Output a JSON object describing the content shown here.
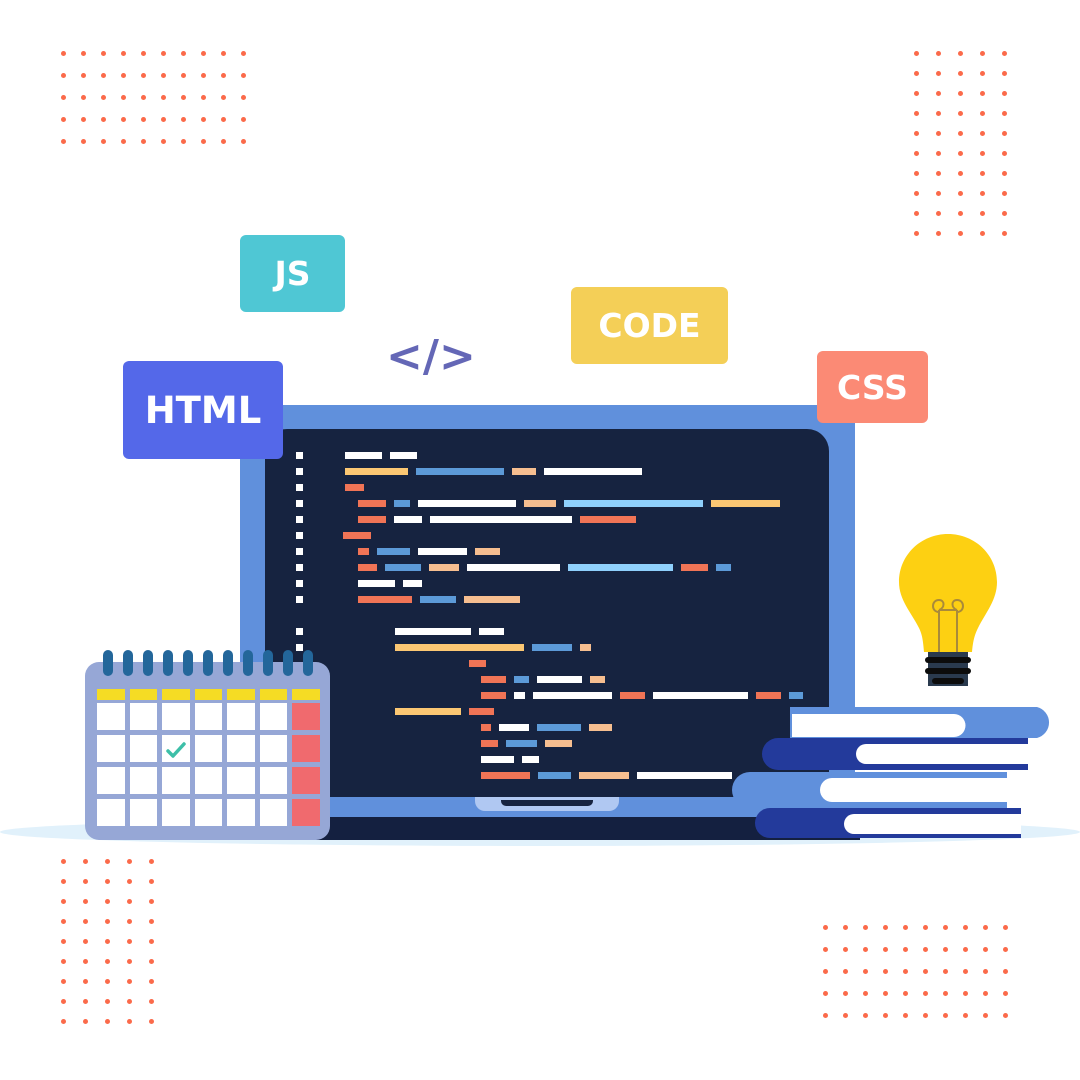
{
  "illustration": {
    "title": "Web development coding illustration",
    "tags": [
      {
        "id": "js",
        "label": "JS",
        "color": "#4fc7d4"
      },
      {
        "id": "html",
        "label": "HTML",
        "color": "#5468e9"
      },
      {
        "id": "code",
        "label": "CODE",
        "color": "#f4cf57"
      },
      {
        "id": "css",
        "label": "CSS",
        "color": "#fb8a75"
      }
    ],
    "code_symbol": "</>",
    "code_symbol_color": "#6467b6",
    "dot_color": "#fb6a4a"
  },
  "palette": {
    "w": "#ffffff",
    "o": "#fbc773",
    "b": "#5c9ad8",
    "p": "#f6be90",
    "r": "#f07456",
    "l": "#8fd0fc"
  },
  "code_lines": [
    {
      "gutter": true,
      "indent": 0,
      "segs": [
        [
          "w",
          37
        ],
        [
          "w",
          27
        ]
      ]
    },
    {
      "gutter": true,
      "indent": 0,
      "segs": [
        [
          "o",
          63
        ],
        [
          "b",
          88
        ],
        [
          "p",
          24
        ],
        [
          "w",
          98
        ]
      ]
    },
    {
      "gutter": true,
      "indent": 0,
      "segs": [
        [
          "r",
          19
        ]
      ]
    },
    {
      "gutter": true,
      "indent": 13,
      "segs": [
        [
          "r",
          28
        ],
        [
          "b",
          16
        ],
        [
          "w",
          98
        ],
        [
          "p",
          32
        ],
        [
          "l",
          139
        ],
        [
          "o",
          69
        ]
      ]
    },
    {
      "gutter": true,
      "indent": 13,
      "segs": [
        [
          "r",
          28
        ],
        [
          "w",
          28
        ],
        [
          "w",
          142
        ],
        [
          "r",
          56
        ]
      ]
    },
    {
      "gutter": true,
      "indent": -2,
      "segs": [
        [
          "r",
          28
        ]
      ]
    },
    {
      "gutter": true,
      "indent": 13,
      "segs": [
        [
          "r",
          11
        ],
        [
          "b",
          33
        ],
        [
          "w",
          49
        ],
        [
          "p",
          25
        ]
      ]
    },
    {
      "gutter": true,
      "indent": 13,
      "segs": [
        [
          "r",
          19
        ],
        [
          "b",
          36
        ],
        [
          "p",
          30
        ],
        [
          "w",
          93
        ],
        [
          "l",
          105
        ],
        [
          "r",
          27
        ],
        [
          "b",
          15
        ]
      ]
    },
    {
      "gutter": true,
      "indent": 13,
      "segs": [
        [
          "w",
          37
        ],
        [
          "w",
          19
        ]
      ]
    },
    {
      "gutter": true,
      "indent": 13,
      "segs": [
        [
          "r",
          54
        ],
        [
          "b",
          36
        ],
        [
          "p",
          56
        ]
      ]
    },
    {
      "gutter": false,
      "indent": 0,
      "segs": []
    },
    {
      "gutter": true,
      "indent": 50,
      "segs": [
        [
          "w",
          76
        ],
        [
          "w",
          25
        ]
      ]
    },
    {
      "gutter": true,
      "indent": 50,
      "segs": [
        [
          "o",
          129
        ],
        [
          "b",
          40
        ],
        [
          "p",
          11
        ]
      ]
    },
    {
      "gutter": false,
      "indent": 124,
      "segs": [
        [
          "r",
          17
        ]
      ]
    },
    {
      "gutter": false,
      "indent": 136,
      "segs": [
        [
          "r",
          25
        ],
        [
          "b",
          15
        ],
        [
          "w",
          45
        ],
        [
          "p",
          15
        ]
      ]
    },
    {
      "gutter": false,
      "indent": 136,
      "segs": [
        [
          "r",
          25
        ],
        [
          "w",
          11
        ],
        [
          "w",
          79
        ],
        [
          "r",
          25
        ],
        [
          "w",
          95
        ],
        [
          "r",
          25
        ],
        [
          "b",
          14
        ]
      ]
    },
    {
      "gutter": false,
      "indent": 50,
      "segs": [
        [
          "o",
          66
        ],
        [
          "r",
          25
        ]
      ]
    },
    {
      "gutter": false,
      "indent": 136,
      "segs": [
        [
          "r",
          10
        ],
        [
          "w",
          30
        ],
        [
          "b",
          44
        ],
        [
          "p",
          23
        ]
      ]
    },
    {
      "gutter": false,
      "indent": 136,
      "segs": [
        [
          "r",
          17
        ],
        [
          "b",
          31
        ],
        [
          "p",
          27
        ]
      ]
    },
    {
      "gutter": false,
      "indent": 136,
      "segs": [
        [
          "w",
          33
        ],
        [
          "w",
          17
        ]
      ]
    },
    {
      "gutter": false,
      "indent": 136,
      "segs": [
        [
          "r",
          49
        ],
        [
          "b",
          33
        ],
        [
          "p",
          50
        ],
        [
          "w",
          95
        ]
      ]
    }
  ],
  "calendar": {
    "columns": 7,
    "rows": 4,
    "checked_cell": {
      "row": 1,
      "col": 2
    },
    "rings": 11
  }
}
